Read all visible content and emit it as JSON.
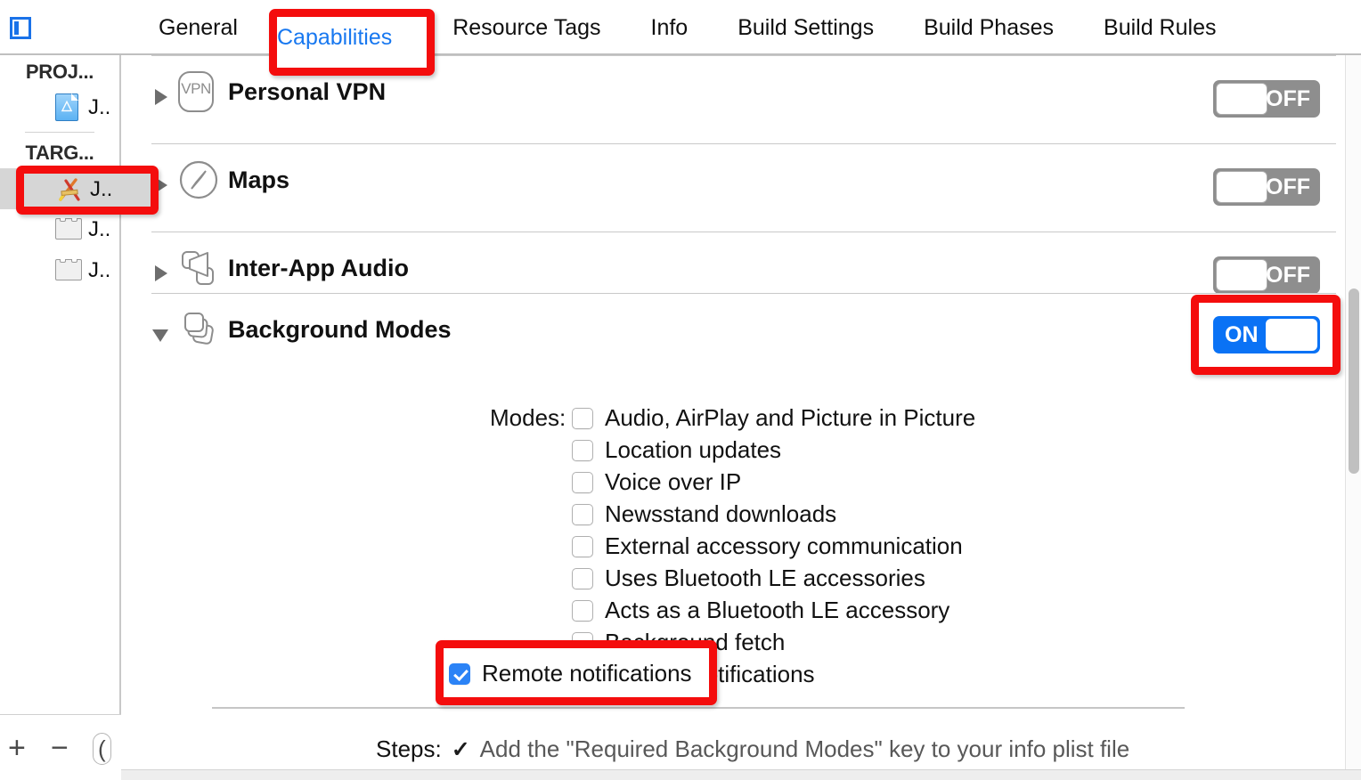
{
  "window": {
    "nav_toggle_icon": "navigator-panel-icon"
  },
  "tabs": [
    {
      "label": "General",
      "selected": false
    },
    {
      "label": "Capabilities",
      "selected": true
    },
    {
      "label": "Resource Tags",
      "selected": false
    },
    {
      "label": "Info",
      "selected": false
    },
    {
      "label": "Build Settings",
      "selected": false
    },
    {
      "label": "Build Phases",
      "selected": false
    },
    {
      "label": "Build Rules",
      "selected": false
    }
  ],
  "sidebar": {
    "project_group": "PROJ...",
    "project_items": [
      {
        "label": "J..",
        "icon": "project-document-icon"
      }
    ],
    "targets_group": "TARG...",
    "target_items": [
      {
        "label": "J..",
        "icon": "app-target-icon",
        "selected": true
      },
      {
        "label": "J..",
        "icon": "test-bundle-icon",
        "selected": false
      },
      {
        "label": "J..",
        "icon": "test-bundle-icon",
        "selected": false
      }
    ],
    "footer": {
      "add_label": "+",
      "remove_label": "−",
      "filter_icon": "filter-icon"
    }
  },
  "capabilities": [
    {
      "title": "Personal VPN",
      "icon": "vpn-icon",
      "icon_text": "VPN",
      "expanded": false,
      "switch_state": "OFF"
    },
    {
      "title": "Maps",
      "icon": "maps-compass-icon",
      "expanded": false,
      "switch_state": "OFF"
    },
    {
      "title": "Inter-App Audio",
      "icon": "inter-app-audio-icon",
      "expanded": false,
      "switch_state": "OFF"
    },
    {
      "title": "Background Modes",
      "icon": "background-modes-icon",
      "expanded": true,
      "switch_state": "ON"
    }
  ],
  "background_modes": {
    "modes_label": "Modes:",
    "items": [
      {
        "label": "Audio, AirPlay and Picture in Picture",
        "checked": false
      },
      {
        "label": "Location updates",
        "checked": false
      },
      {
        "label": "Voice over IP",
        "checked": false
      },
      {
        "label": "Newsstand downloads",
        "checked": false
      },
      {
        "label": "External accessory communication",
        "checked": false
      },
      {
        "label": "Uses Bluetooth LE accessories",
        "checked": false
      },
      {
        "label": "Acts as a Bluetooth LE accessory",
        "checked": false
      },
      {
        "label": "Background fetch",
        "checked": false
      },
      {
        "label": "Remote notifications",
        "checked": true
      }
    ],
    "steps_label": "Steps:",
    "steps_check": "✓",
    "steps_text": "Add the \"Required Background Modes\" key to your info plist file"
  },
  "colors": {
    "accent_blue": "#1878f0",
    "switch_on": "#0a72f5",
    "switch_off": "#8e8e8e",
    "checkbox_checked": "#2b83f6",
    "annotation_red": "#f40d0d"
  },
  "annotations": [
    {
      "name": "capabilities-tab-highlight"
    },
    {
      "name": "target-row-highlight"
    },
    {
      "name": "background-modes-switch-highlight"
    },
    {
      "name": "remote-notifications-highlight"
    }
  ]
}
